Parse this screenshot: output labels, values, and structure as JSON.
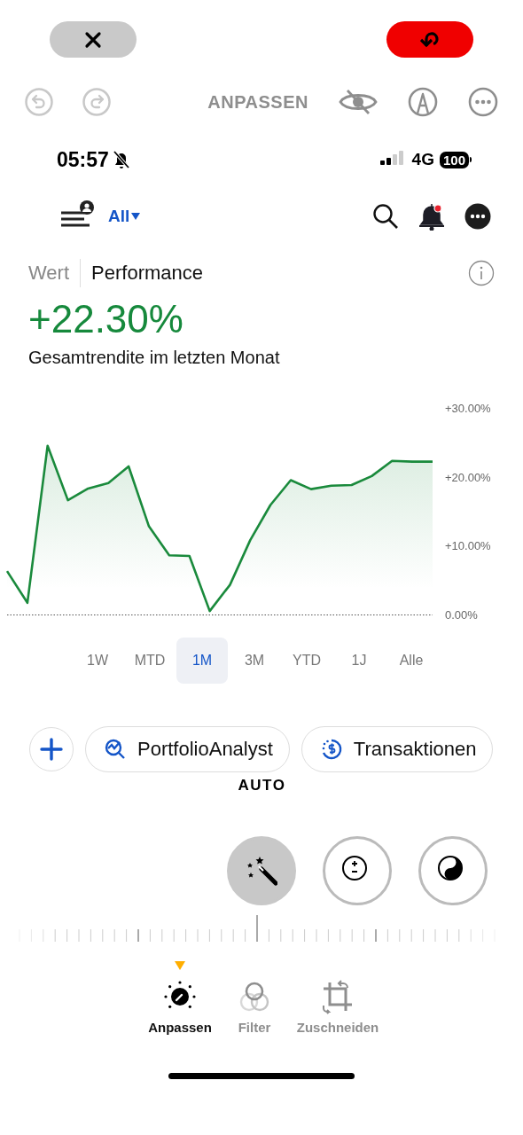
{
  "editor": {
    "title": "ANPASSEN"
  },
  "screenshot": {
    "status_bar": {
      "time": "05:57",
      "network": "4G",
      "battery": "100"
    },
    "nav": {
      "filter": "All"
    },
    "segments": [
      {
        "label": "Wert",
        "selected": false
      },
      {
        "label": "Performance",
        "selected": true
      }
    ],
    "value": "+22.30%",
    "subtitle": "Gesamtrendite im letzten Monat",
    "chart_data": {
      "type": "area",
      "series": [
        {
          "color": "#1a8a3c",
          "values": [
            6.3,
            1.7,
            24.5,
            16.6,
            18.3,
            19.1,
            21.5,
            12.8,
            8.6,
            8.5,
            0.5,
            4.3,
            10.8,
            15.9,
            19.5,
            18.2,
            18.7,
            18.8,
            20.1,
            22.3,
            22.2,
            22.2
          ]
        }
      ],
      "ylim": [
        0,
        30
      ],
      "yticks": [
        {
          "value": 0,
          "label": "0.00%"
        },
        {
          "value": 10,
          "label": "+10.00%"
        },
        {
          "value": 20,
          "label": "+20.00%"
        },
        {
          "value": 30,
          "label": "+30.00%"
        }
      ]
    },
    "ranges": [
      {
        "label": "1W",
        "selected": false
      },
      {
        "label": "MTD",
        "selected": false
      },
      {
        "label": "1M",
        "selected": true
      },
      {
        "label": "3M",
        "selected": false
      },
      {
        "label": "YTD",
        "selected": false
      },
      {
        "label": "1J",
        "selected": false
      },
      {
        "label": "Alle",
        "selected": false
      }
    ],
    "actions": [
      {
        "kind": "analyst",
        "label": "PortfolioAnalyst"
      },
      {
        "kind": "transactions",
        "label": "Transaktionen"
      }
    ]
  },
  "adjust": {
    "mode": "AUTO",
    "tools": [
      {
        "kind": "auto",
        "selected": true
      },
      {
        "kind": "exposure",
        "selected": false
      },
      {
        "kind": "brilliance",
        "selected": false
      }
    ]
  },
  "tabs": [
    {
      "kind": "adjust",
      "label": "Anpassen",
      "selected": true
    },
    {
      "kind": "filter",
      "label": "Filter",
      "selected": false
    },
    {
      "kind": "crop",
      "label": "Zuschneiden",
      "selected": false
    }
  ]
}
